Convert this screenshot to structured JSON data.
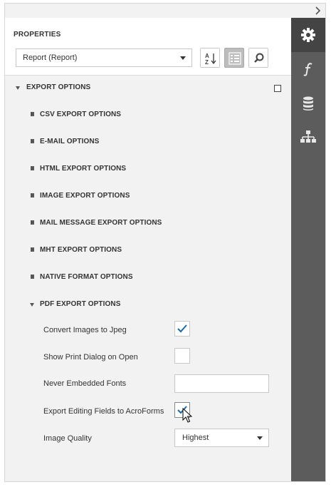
{
  "panel": {
    "title": "PROPERTIES",
    "selected_object": "Report (Report)"
  },
  "toolbar": {
    "sort_icon": "sort-alphabetical-icon",
    "categories_icon": "categories-icon",
    "search_icon": "search-icon"
  },
  "export_options": {
    "label": "EXPORT OPTIONS",
    "groups": [
      {
        "label": "CSV EXPORT OPTIONS",
        "expanded": false
      },
      {
        "label": "E-MAIL OPTIONS",
        "expanded": false
      },
      {
        "label": "HTML EXPORT OPTIONS",
        "expanded": false
      },
      {
        "label": "IMAGE EXPORT OPTIONS",
        "expanded": false
      },
      {
        "label": "MAIL MESSAGE EXPORT OPTIONS",
        "expanded": false
      },
      {
        "label": "MHT EXPORT OPTIONS",
        "expanded": false
      },
      {
        "label": "NATIVE FORMAT OPTIONS",
        "expanded": false
      },
      {
        "label": "PDF EXPORT OPTIONS",
        "expanded": true
      }
    ]
  },
  "pdf_options": {
    "convert_images_label": "Convert Images to Jpeg",
    "convert_images_checked": true,
    "show_print_dialog_label": "Show Print Dialog on Open",
    "show_print_dialog_checked": false,
    "never_embedded_fonts_label": "Never Embedded Fonts",
    "never_embedded_fonts_value": "",
    "export_editing_fields_label": "Export Editing Fields to AcroForms",
    "export_editing_fields_checked": true,
    "image_quality_label": "Image Quality",
    "image_quality_value": "Highest"
  },
  "side_tabs": [
    {
      "icon": "gear-icon",
      "active": true
    },
    {
      "icon": "function-icon",
      "active": false
    },
    {
      "icon": "database-icon",
      "active": false
    },
    {
      "icon": "report-explorer-icon",
      "active": false
    }
  ],
  "colors": {
    "accent": "#1e6aa6",
    "sidebar": "#5c5c5c",
    "sidebar_active": "#444444",
    "panel_background": "#f2f2f2"
  }
}
